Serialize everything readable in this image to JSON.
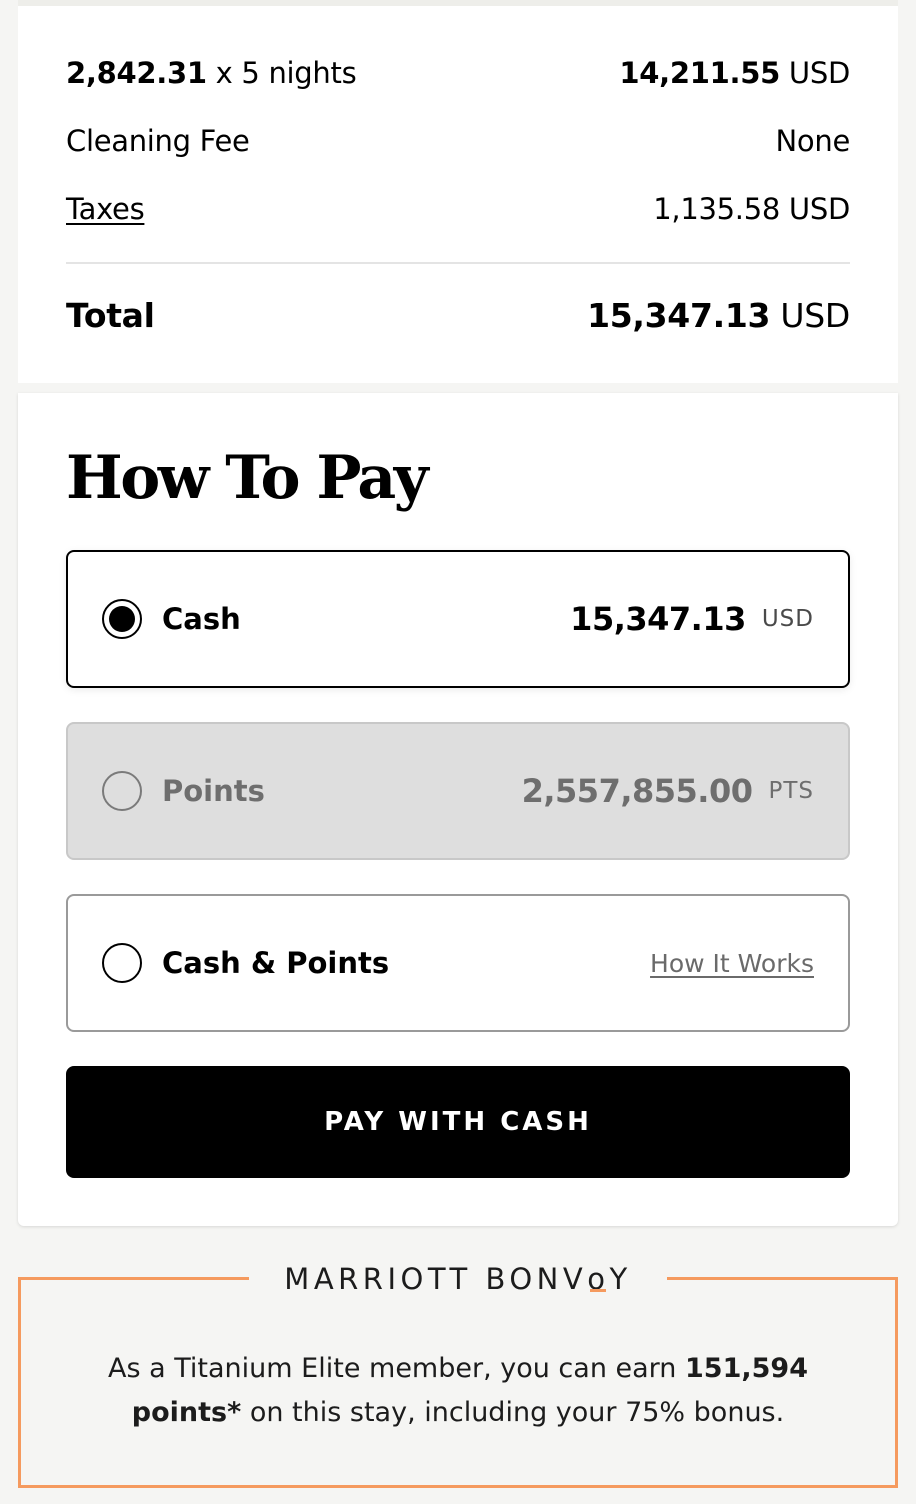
{
  "summary": {
    "rate_amount": "2,842.31",
    "rate_suffix": " x 5 nights",
    "subtotal_amount": "14,211.55",
    "subtotal_currency": " USD",
    "cleaning_label": "Cleaning Fee",
    "cleaning_value": "None",
    "taxes_label": "Taxes",
    "taxes_value": "1,135.58 USD",
    "total_label": "Total",
    "total_amount": "15,347.13",
    "total_currency": " USD"
  },
  "how_to_pay": {
    "title": "How To Pay",
    "options": [
      {
        "label": "Cash",
        "amount": "15,347.13",
        "unit": "USD",
        "selected": true
      },
      {
        "label": "Points",
        "amount": "2,557,855.00",
        "unit": "PTS",
        "selected": false,
        "disabled": true
      },
      {
        "label": "Cash & Points",
        "link": "How It Works",
        "selected": false
      }
    ],
    "cta_label": "PAY WITH CASH"
  },
  "bonvoy": {
    "brand_before": "MARRIOTT BONV",
    "brand_o": "o",
    "brand_after": "Y",
    "message_prefix": "As a Titanium Elite member, you can earn ",
    "message_bold": "151,594 points*",
    "message_suffix": " on this stay, including your 75% bonus."
  },
  "colors": {
    "accent": "#f59a5e",
    "selected": "#000000",
    "disabled_bg": "#dedede"
  }
}
